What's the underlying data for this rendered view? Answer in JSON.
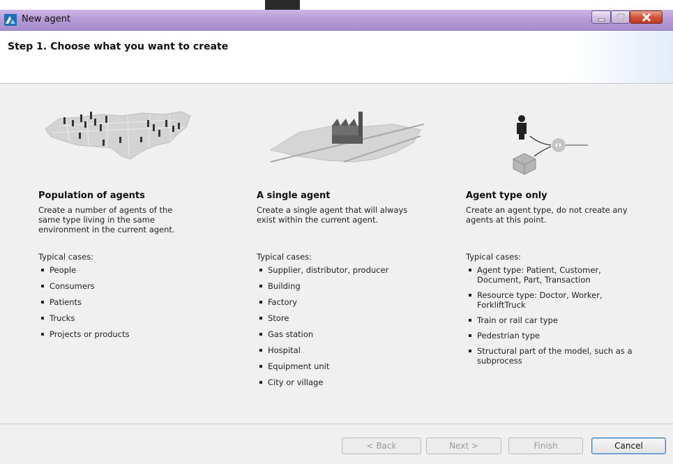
{
  "window": {
    "title": "New agent"
  },
  "header": {
    "step_title": "Step 1. Choose what you want to create"
  },
  "options": [
    {
      "title": "Population of agents",
      "description_lines": [
        "Create a number of agents of the",
        "same type living in the same",
        "environment in the current agent."
      ],
      "cases_label": "Typical cases:",
      "cases": [
        [
          "People"
        ],
        [
          "Consumers"
        ],
        [
          "Patients"
        ],
        [
          "Trucks"
        ],
        [
          "Projects or products"
        ]
      ]
    },
    {
      "title": "A single agent",
      "description_lines": [
        "Create a single agent that will always",
        "exist within the current agent."
      ],
      "cases_label": "Typical cases:",
      "cases": [
        [
          "Supplier, distributor, producer"
        ],
        [
          "Building"
        ],
        [
          "Factory"
        ],
        [
          "Store"
        ],
        [
          "Gas station"
        ],
        [
          "Hospital"
        ],
        [
          "Equipment unit"
        ],
        [
          "City or village"
        ]
      ]
    },
    {
      "title": "Agent type only",
      "description_lines": [
        "Create an agent type, do not create any",
        "agents at this point."
      ],
      "cases_label": "Typical cases:",
      "cases": [
        [
          "Agent type: Patient, Customer,",
          "Document, Part, Transaction"
        ],
        [
          "Resource type: Doctor, Worker,",
          "ForkliftTruck"
        ],
        [
          "Train or rail car type"
        ],
        [
          "Pedestrian type"
        ],
        [
          "Structural part of the model, such as a",
          "subprocess"
        ]
      ]
    }
  ],
  "footer": {
    "back_label": "< Back",
    "next_label": "Next >",
    "finish_label": "Finish",
    "cancel_label": "Cancel"
  },
  "icons": [
    "app-logo-icon",
    "minimize-icon",
    "maximize-icon",
    "close-icon",
    "usa-map-people-icon",
    "factory-terrain-icon",
    "agent-type-icon"
  ],
  "colors": {
    "titlebar": "#b79bd7",
    "content_bg": "#f0f0f0",
    "close_button": "#d2553c",
    "default_button_border": "#3b7bbf"
  }
}
